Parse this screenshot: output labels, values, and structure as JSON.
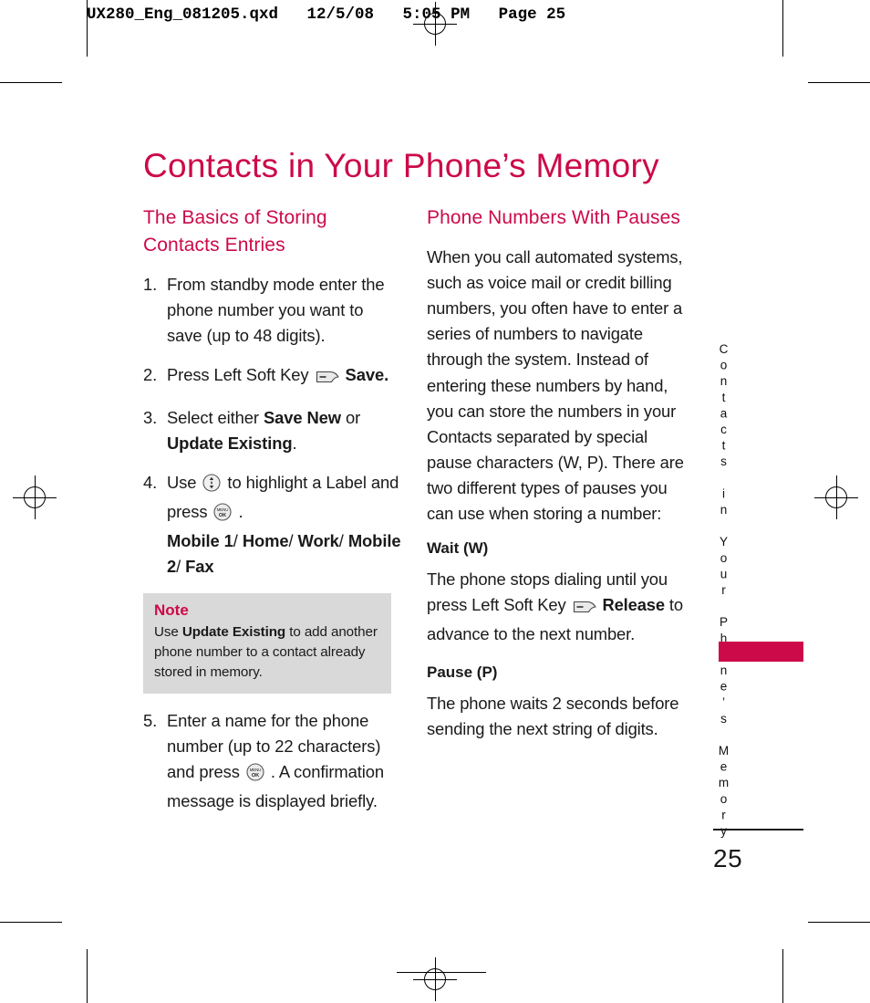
{
  "print_strip": {
    "text": "UX280_Eng_081205.qxd   12/5/08   5:05 PM   Page 25"
  },
  "page": {
    "title": "Contacts in Your Phone’s Memory",
    "number": "25",
    "running_head": "Contacts in Your Phone’s Memory",
    "accent_color": "#cc0a49",
    "note_background": "#d9d9d9",
    "text_color": "#1a1a1a"
  },
  "left_column": {
    "heading": "The Basics of Storing Contacts Entries",
    "steps": [
      {
        "num": "1.",
        "parts": [
          {
            "t": "From standby mode enter the phone number you want to save (up to 48 digits)."
          }
        ]
      },
      {
        "num": "2.",
        "parts": [
          {
            "t": "Press Left Soft Key "
          },
          {
            "icon": "soft-key-icon"
          },
          {
            "t": " "
          },
          {
            "t": "Save.",
            "b": true
          }
        ]
      },
      {
        "num": "3.",
        "parts": [
          {
            "t": "Select either "
          },
          {
            "t": "Save New",
            "b": true
          },
          {
            "t": " or "
          },
          {
            "t": "Update Existing",
            "b": true
          },
          {
            "t": "."
          }
        ]
      },
      {
        "num": "4.",
        "parts": [
          {
            "t": "Use "
          },
          {
            "icon": "navigation-pad-icon"
          },
          {
            "t": " to highlight a Label and press "
          },
          {
            "icon": "menu-ok-button-icon"
          },
          {
            "t": " ."
          },
          {
            "br": true
          },
          {
            "t": "Mobile 1",
            "b": true
          },
          {
            "t": "/ "
          },
          {
            "t": "Home",
            "b": true
          },
          {
            "t": "/ "
          },
          {
            "t": "Work",
            "b": true
          },
          {
            "t": "/ "
          },
          {
            "t": "Mobile 2",
            "b": true
          },
          {
            "t": "/ "
          },
          {
            "t": "Fax",
            "b": true
          }
        ]
      }
    ],
    "note": {
      "title": "Note",
      "parts": [
        {
          "t": "Use "
        },
        {
          "t": "Update Existing",
          "b": true
        },
        {
          "t": " to add another phone number to a contact already stored in memory."
        }
      ]
    },
    "steps_after_note": [
      {
        "num": "5.",
        "parts": [
          {
            "t": "Enter a name for the phone number (up to 22 characters) and press "
          },
          {
            "icon": "menu-ok-button-icon"
          },
          {
            "t": " . A confirmation message is displayed briefly."
          }
        ]
      }
    ]
  },
  "right_column": {
    "heading": "Phone Numbers With Pauses",
    "intro": "When you call automated systems, such as voice mail or credit billing numbers, you often have to enter a series of numbers to navigate through the system. Instead of entering these numbers by hand, you can store the numbers in your Contacts separated by special pause characters (W, P). There are two different types of pauses you can use when storing a number:",
    "subsections": [
      {
        "heading": "Wait (W)",
        "parts": [
          {
            "t": "The phone stops dialing until you press Left Soft Key "
          },
          {
            "icon": "soft-key-icon"
          },
          {
            "t": " "
          },
          {
            "t": "Release",
            "b": true
          },
          {
            "t": " to advance to the next number."
          }
        ]
      },
      {
        "heading": "Pause (P)",
        "parts": [
          {
            "t": "The phone waits 2 seconds before sending the next string of digits."
          }
        ]
      }
    ]
  },
  "icons": {
    "soft-key-icon": "soft-key-icon",
    "navigation-pad-icon": "navigation-pad-icon",
    "menu-ok-button-icon": "menu-ok-button-icon",
    "registration-mark": "registration-mark",
    "crop-mark": "crop-mark"
  }
}
